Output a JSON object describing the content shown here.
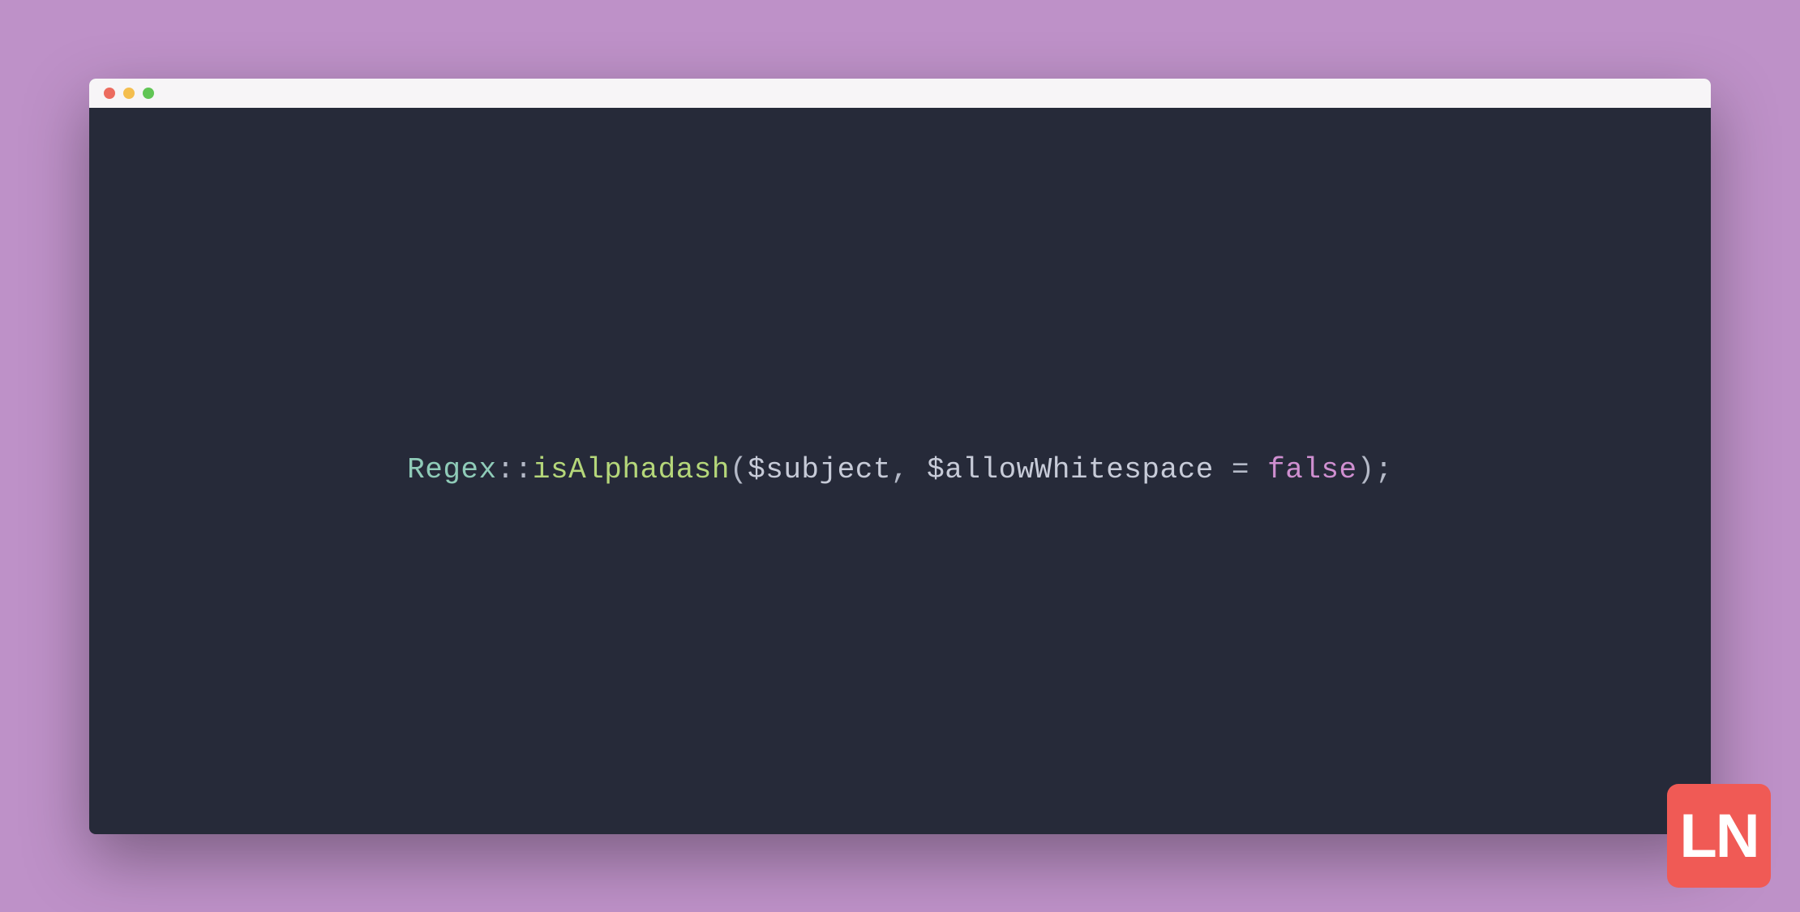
{
  "window": {
    "titlebar": {
      "dots": {
        "red": "#ec6b5f",
        "yellow": "#f4be4f",
        "green": "#61c555"
      }
    }
  },
  "code": {
    "class_name": "Regex",
    "double_colon": "::",
    "method_name": "isAlphadash",
    "open_paren": "(",
    "var1": "$subject",
    "comma_space": ", ",
    "var2": "$allowWhitespace",
    "space_eq_space": " = ",
    "keyword_false": "false",
    "close_paren": ")",
    "semicolon": ";"
  },
  "logo": {
    "text": "LN"
  },
  "colors": {
    "background": "#be91c8",
    "editor_bg": "#262a39",
    "titlebar_bg": "#f7f5f7",
    "logo_bg": "#f05a55",
    "class": "#8fcbb8",
    "method": "#b5d77a",
    "variable": "#c7cbd8",
    "keyword": "#cf8fd0",
    "punctuation": "#b4b9c7"
  }
}
